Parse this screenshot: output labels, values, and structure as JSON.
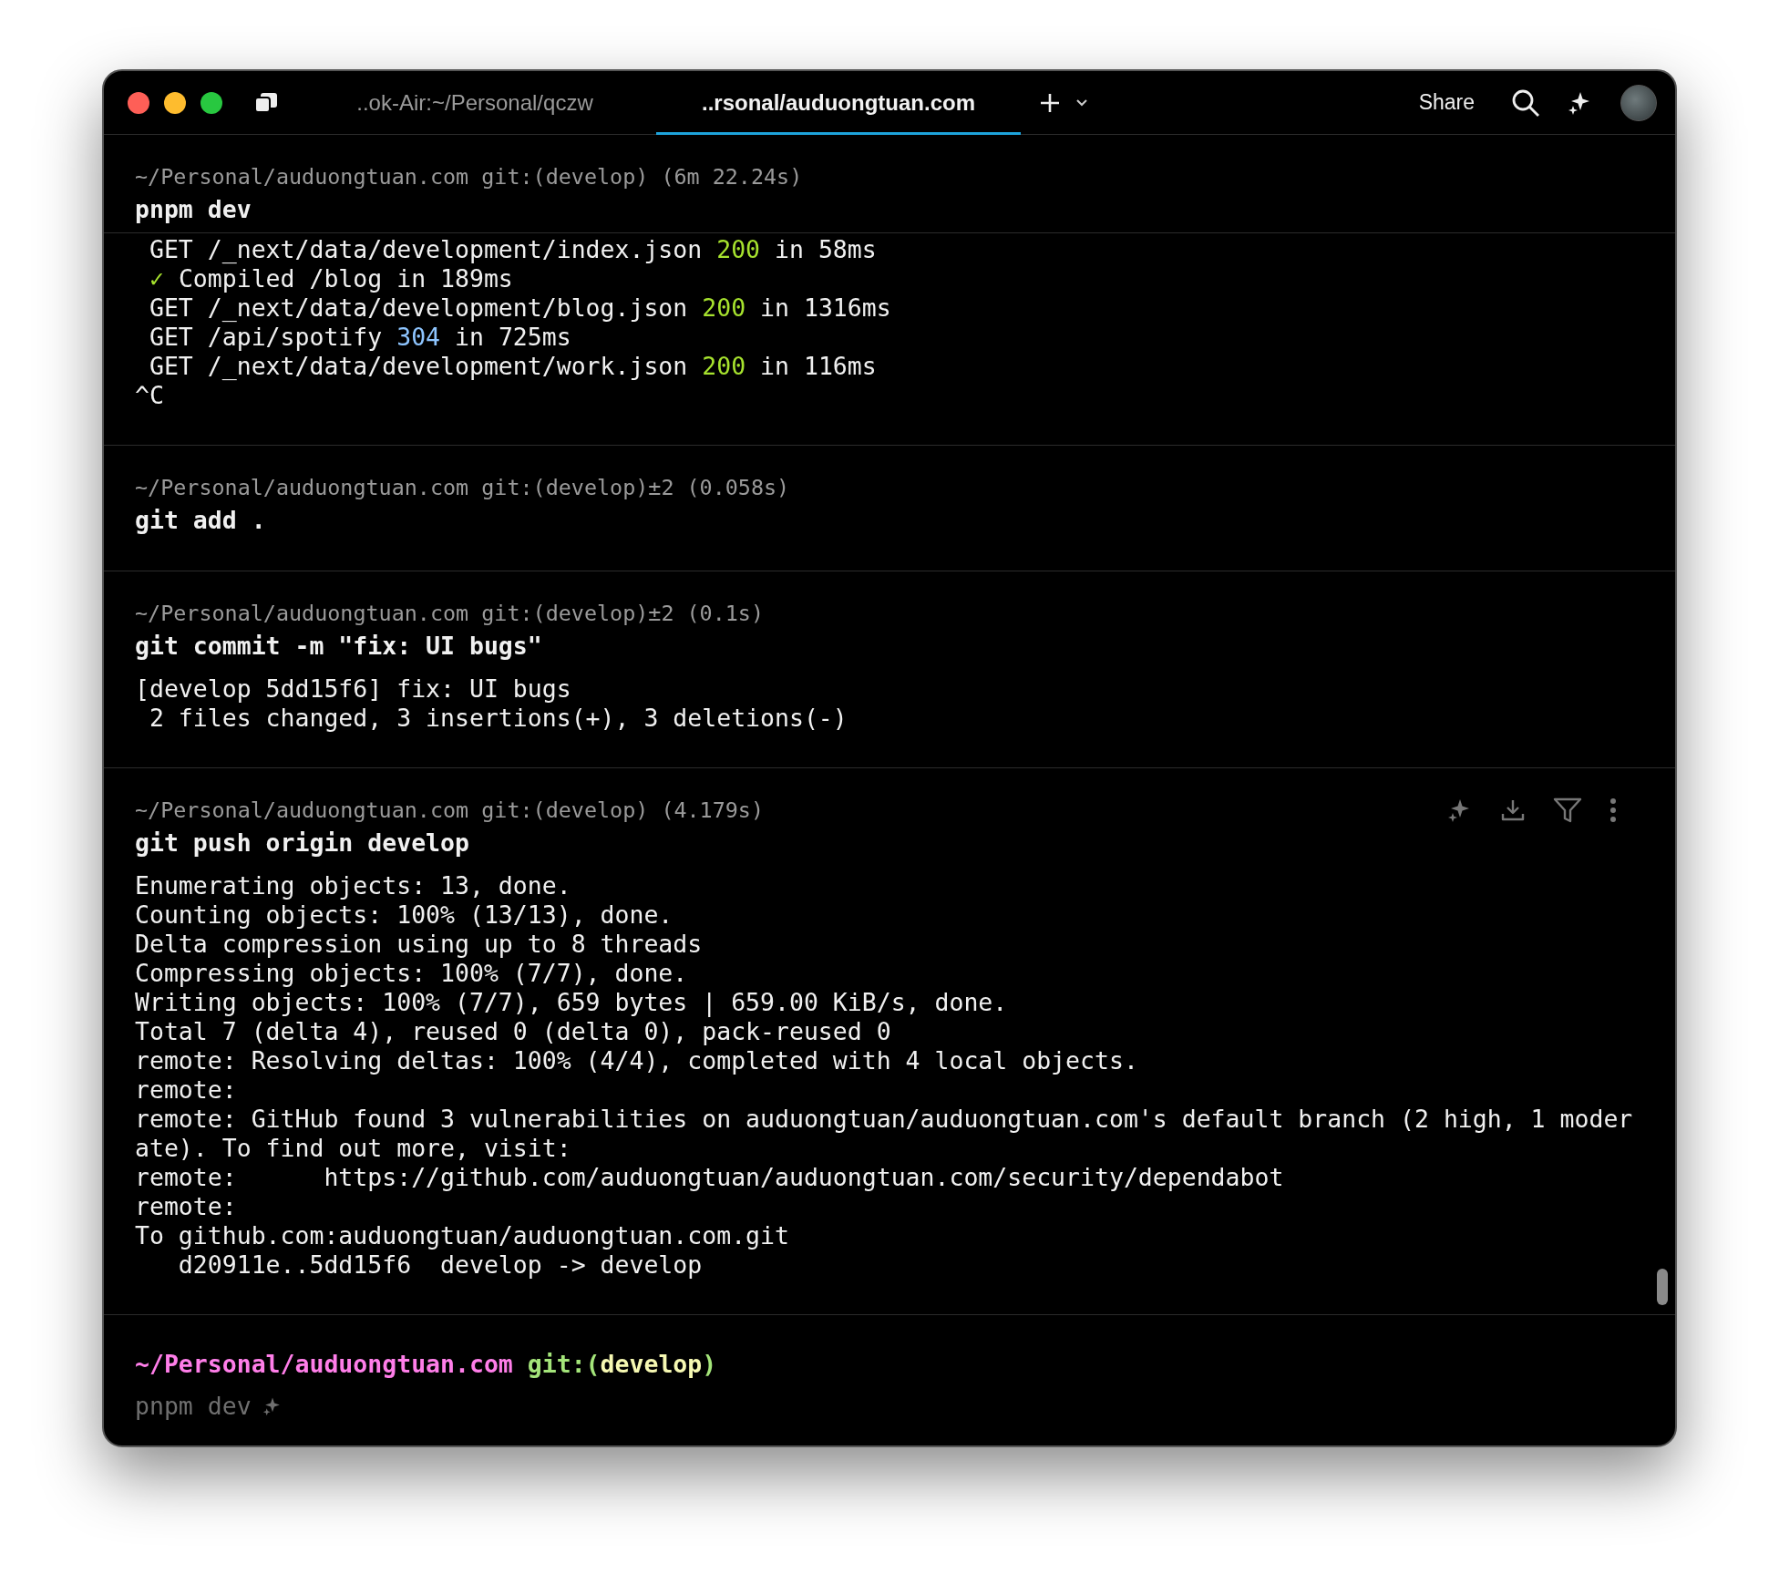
{
  "tabs": [
    {
      "label": "..ok-Air:~/Personal/qczw",
      "selected": false
    },
    {
      "label": "..rsonal/auduongtuan.com",
      "selected": true
    }
  ],
  "share": "Share",
  "blocks": [
    {
      "header": "~/Personal/auduongtuan.com git:(develop) (6m 22.24s)",
      "command": "pnpm dev",
      "sticky": true,
      "toolbar": false,
      "output": [
        [
          {
            "text": " GET /_next/data/development/index.json ",
            "kind": "plain"
          },
          {
            "text": "200",
            "kind": "success"
          },
          {
            "text": " in 58ms",
            "kind": "plain"
          }
        ],
        [
          {
            "text": " ✓",
            "kind": "success"
          },
          {
            "text": " Compiled /blog in 189ms",
            "kind": "plain"
          }
        ],
        [
          {
            "text": " GET /_next/data/development/blog.json ",
            "kind": "plain"
          },
          {
            "text": "200",
            "kind": "success"
          },
          {
            "text": " in 1316ms",
            "kind": "plain"
          }
        ],
        [
          {
            "text": " GET /api/spotify ",
            "kind": "plain"
          },
          {
            "text": "304",
            "kind": "info"
          },
          {
            "text": " in 725ms",
            "kind": "plain"
          }
        ],
        [
          {
            "text": " GET /_next/data/development/work.json ",
            "kind": "plain"
          },
          {
            "text": "200",
            "kind": "success"
          },
          {
            "text": " in 116ms",
            "kind": "plain"
          }
        ],
        [
          {
            "text": "^C",
            "kind": "plain"
          }
        ]
      ]
    },
    {
      "header": "~/Personal/auduongtuan.com git:(develop)±2 (0.058s)",
      "command": "git add .",
      "sticky": false,
      "toolbar": false
    },
    {
      "header": "~/Personal/auduongtuan.com git:(develop)±2 (0.1s)",
      "command": "git commit -m \"fix: UI bugs\"",
      "sticky": false,
      "toolbar": false,
      "output": [
        [
          {
            "text": "[develop 5dd15f6] fix: UI bugs",
            "kind": "plain"
          }
        ],
        [
          {
            "text": " 2 files changed, 3 insertions(+), 3 deletions(-)",
            "kind": "plain"
          }
        ]
      ]
    },
    {
      "header": "~/Personal/auduongtuan.com git:(develop) (4.179s)",
      "command": "git push origin develop",
      "sticky": false,
      "toolbar": true,
      "output": [
        [
          {
            "text": "Enumerating objects: 13, done.",
            "kind": "plain"
          }
        ],
        [
          {
            "text": "Counting objects: 100% (13/13), done.",
            "kind": "plain"
          }
        ],
        [
          {
            "text": "Delta compression using up to 8 threads",
            "kind": "plain"
          }
        ],
        [
          {
            "text": "Compressing objects: 100% (7/7), done.",
            "kind": "plain"
          }
        ],
        [
          {
            "text": "Writing objects: 100% (7/7), 659 bytes | 659.00 KiB/s, done.",
            "kind": "plain"
          }
        ],
        [
          {
            "text": "Total 7 (delta 4), reused 0 (delta 0), pack-reused 0",
            "kind": "plain"
          }
        ],
        [
          {
            "text": "remote: Resolving deltas: 100% (4/4), completed with 4 local objects.",
            "kind": "plain"
          }
        ],
        [
          {
            "text": "remote:",
            "kind": "plain"
          }
        ],
        [
          {
            "text": "remote: GitHub found 3 vulnerabilities on auduongtuan/auduongtuan.com's default branch (2 high, 1 moder",
            "kind": "plain"
          }
        ],
        [
          {
            "text": "ate). To find out more, visit:",
            "kind": "plain"
          }
        ],
        [
          {
            "text": "remote:      https://github.com/auduongtuan/auduongtuan.com/security/dependabot",
            "kind": "plain"
          }
        ],
        [
          {
            "text": "remote:",
            "kind": "plain"
          }
        ],
        [
          {
            "text": "To github.com:auduongtuan/auduongtuan.com.git",
            "kind": "plain"
          }
        ],
        [
          {
            "text": "   d20911e..5dd15f6  develop -> develop",
            "kind": "plain"
          }
        ]
      ]
    }
  ],
  "prompt": {
    "path": "~/Personal/auduongtuan.com",
    "git_open": "git:(",
    "branch": "develop",
    "git_close": ")",
    "suggestion": "pnpm dev"
  }
}
